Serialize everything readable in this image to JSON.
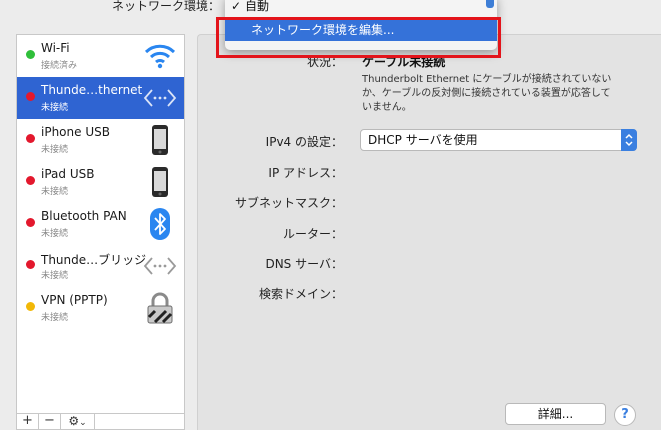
{
  "location": {
    "label": "ネットワーク環境：",
    "menu": {
      "check": "✓",
      "current": "自動",
      "edit_item": "ネットワーク環境を編集..."
    }
  },
  "services": [
    {
      "name": "Wi-Fi",
      "status": "接続済み",
      "dot": "#2fbf3a",
      "icon": "wifi-icon"
    },
    {
      "name": "Thunde…thernet",
      "status": "未接続",
      "dot": "#e3182d",
      "icon": "ethernet-arrows-icon"
    },
    {
      "name": "iPhone USB",
      "status": "未接続",
      "dot": "#e3182d",
      "icon": "iphone-icon"
    },
    {
      "name": "iPad USB",
      "status": "未接続",
      "dot": "#e3182d",
      "icon": "ipad-icon"
    },
    {
      "name": "Bluetooth PAN",
      "status": "未接続",
      "dot": "#e3182d",
      "icon": "bluetooth-icon"
    },
    {
      "name": "Thunde…ブリッジ",
      "status": "未接続",
      "dot": "#e3182d",
      "icon": "bridge-arrows-icon"
    },
    {
      "name": "VPN (PPTP)",
      "status": "未接続",
      "dot": "#f2b807",
      "icon": "vpn-lock-icon"
    }
  ],
  "list_controls": {
    "add": "+",
    "remove": "−",
    "gear": "⚙",
    "chevron": "⌄"
  },
  "detail": {
    "status_label": "状況：",
    "status_value": "ケーブル未接続",
    "status_desc": "Thunderbolt Ethernet にケーブルが接続されていないか、ケーブルの反対側に接続されている装置が応答していません。",
    "ipv4_label": "IPv4 の設定：",
    "ipv4_value": "DHCP サーバを使用",
    "ip_label": "IP アドレス：",
    "subnet_label": "サブネットマスク：",
    "router_label": "ルーター：",
    "dns_label": "DNS サーバ：",
    "search_label": "検索ドメイン："
  },
  "buttons": {
    "advanced": "詳細...",
    "help": "?"
  },
  "colors": {
    "selection": "#2f64d2",
    "accent": "#3a7fe0",
    "highlight": "#e3141b"
  }
}
